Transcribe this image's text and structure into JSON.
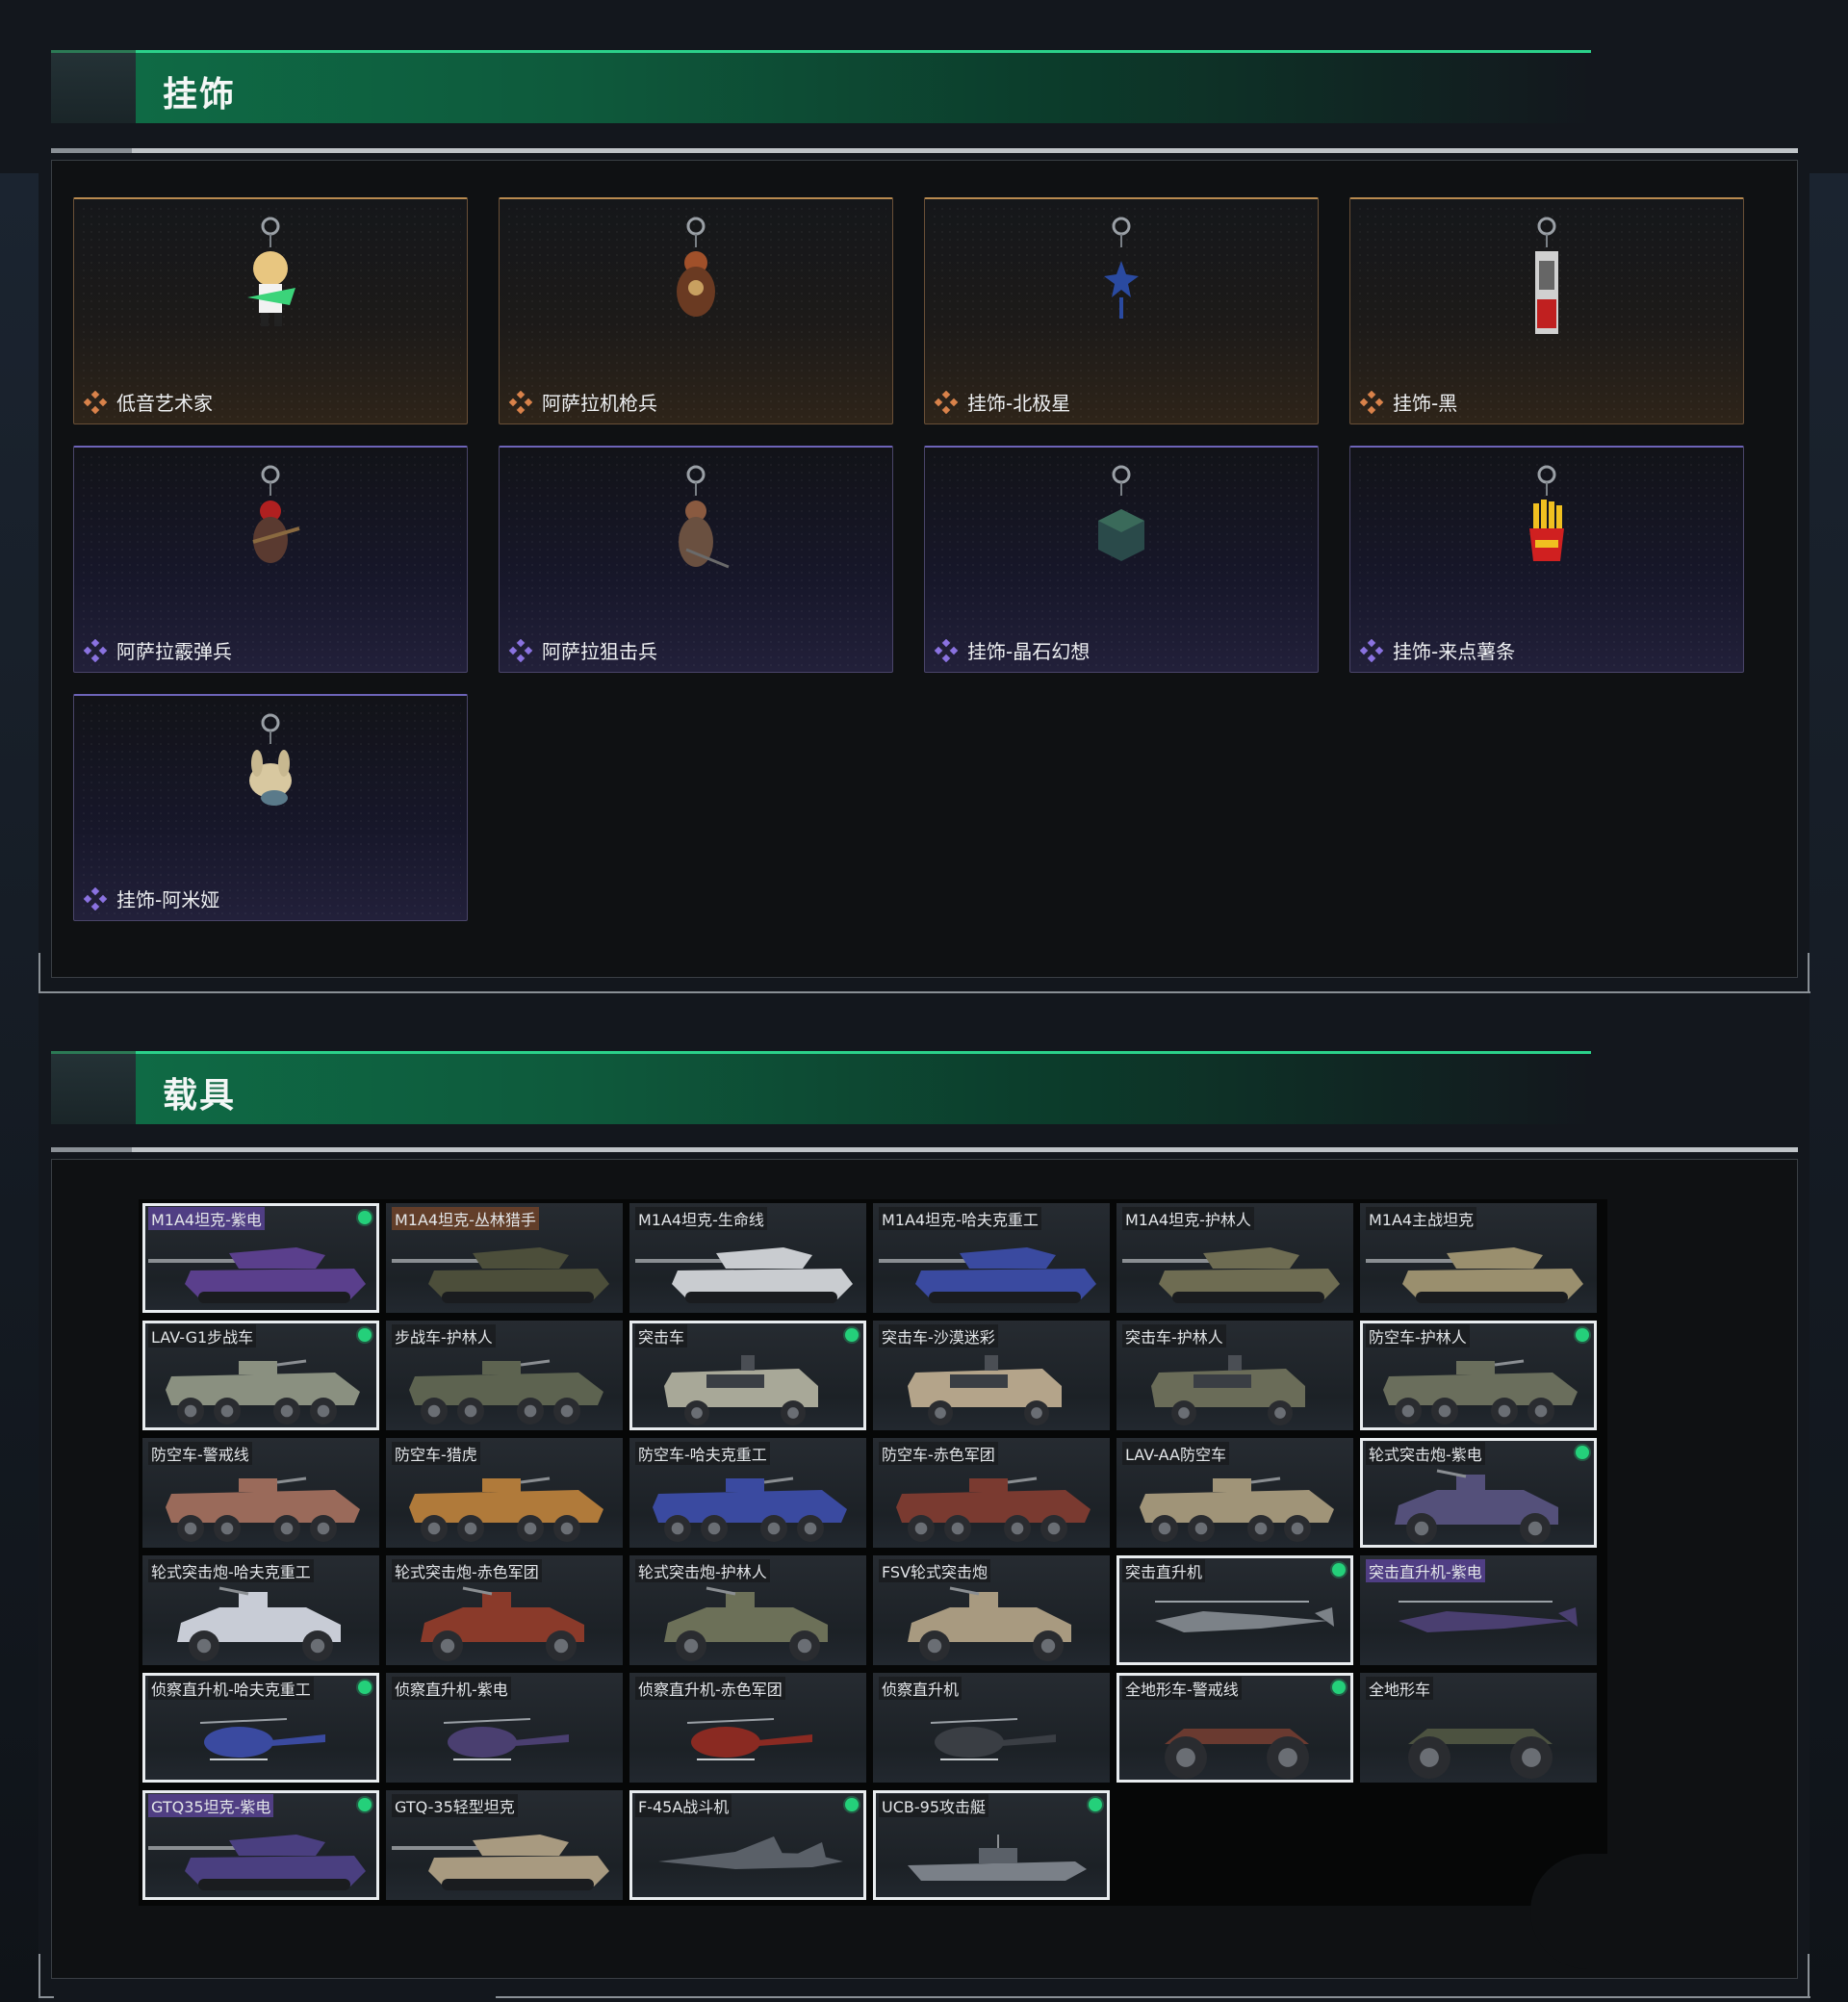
{
  "colors": {
    "accent_green": "#2bd18a",
    "orange_rarity": "#d9824a",
    "purple_rarity": "#8a72e0",
    "owned_dot": "#24d07a"
  },
  "pendants": {
    "title": "挂饰",
    "items": [
      {
        "name": "低音艺术家",
        "rarity": "orange",
        "icon": "bassist-figure-icon"
      },
      {
        "name": "阿萨拉机枪兵",
        "rarity": "orange",
        "icon": "gunner-figure-icon"
      },
      {
        "name": "挂饰-北极星",
        "rarity": "orange",
        "icon": "star-pendant-icon"
      },
      {
        "name": "挂饰-黑",
        "rarity": "orange",
        "icon": "tag-pendant-icon"
      },
      {
        "name": "阿萨拉霰弹兵",
        "rarity": "purple",
        "icon": "shotgunner-figure-icon"
      },
      {
        "name": "阿萨拉狙击兵",
        "rarity": "purple",
        "icon": "sniper-figure-icon"
      },
      {
        "name": "挂饰-晶石幻想",
        "rarity": "purple",
        "icon": "crystal-cube-icon"
      },
      {
        "name": "挂饰-来点薯条",
        "rarity": "purple",
        "icon": "fries-pendant-icon"
      },
      {
        "name": "挂饰-阿米娅",
        "rarity": "purple",
        "icon": "plush-pendant-icon"
      }
    ]
  },
  "vehicles": {
    "title": "载具",
    "items": [
      {
        "name": "M1A4坦克-紫电",
        "type": "tank",
        "tag": "purple",
        "selected": true,
        "owned": true,
        "paint": "#5a3f8c"
      },
      {
        "name": "M1A4坦克-丛林猎手",
        "type": "tank",
        "tag": "orange",
        "selected": false,
        "owned": false,
        "paint": "#4c4e3a"
      },
      {
        "name": "M1A4坦克-生命线",
        "type": "tank",
        "tag": "none",
        "selected": false,
        "owned": false,
        "paint": "#c9ccd0"
      },
      {
        "name": "M1A4坦克-哈夫克重工",
        "type": "tank",
        "tag": "none",
        "selected": false,
        "owned": false,
        "paint": "#3a4aa0"
      },
      {
        "name": "M1A4坦克-护林人",
        "type": "tank",
        "tag": "none",
        "selected": false,
        "owned": false,
        "paint": "#6e6c52"
      },
      {
        "name": "M1A4主战坦克",
        "type": "tank",
        "tag": "none",
        "selected": false,
        "owned": false,
        "paint": "#9a8f6e"
      },
      {
        "name": "LAV-G1步战车",
        "type": "apc",
        "tag": "none",
        "selected": true,
        "owned": true,
        "paint": "#8a9080"
      },
      {
        "name": "步战车-护林人",
        "type": "apc",
        "tag": "none",
        "selected": false,
        "owned": false,
        "paint": "#5d6350"
      },
      {
        "name": "突击车",
        "type": "mrap",
        "tag": "none",
        "selected": true,
        "owned": true,
        "paint": "#a8a898"
      },
      {
        "name": "突击车-沙漠迷彩",
        "type": "mrap",
        "tag": "none",
        "selected": false,
        "owned": false,
        "paint": "#b4a48a"
      },
      {
        "name": "突击车-护林人",
        "type": "mrap",
        "tag": "none",
        "selected": false,
        "owned": false,
        "paint": "#6a6c58"
      },
      {
        "name": "防空车-护林人",
        "type": "apc",
        "tag": "none",
        "selected": true,
        "owned": true,
        "paint": "#6a6e5c"
      },
      {
        "name": "防空车-警戒线",
        "type": "apc",
        "tag": "none",
        "selected": false,
        "owned": false,
        "paint": "#9a6a5a"
      },
      {
        "name": "防空车-猎虎",
        "type": "apc",
        "tag": "none",
        "selected": false,
        "owned": false,
        "paint": "#b07a3a"
      },
      {
        "name": "防空车-哈夫克重工",
        "type": "apc",
        "tag": "none",
        "selected": false,
        "owned": false,
        "paint": "#3a4aa0"
      },
      {
        "name": "防空车-赤色军团",
        "type": "apc",
        "tag": "none",
        "selected": false,
        "owned": false,
        "paint": "#7a3a30"
      },
      {
        "name": "LAV-AA防空车",
        "type": "apc",
        "tag": "none",
        "selected": false,
        "owned": false,
        "paint": "#a09478"
      },
      {
        "name": "轮式突击炮-紫电",
        "type": "buggy",
        "tag": "none",
        "selected": true,
        "owned": true,
        "paint": "#54507a"
      },
      {
        "name": "轮式突击炮-哈夫克重工",
        "type": "buggy",
        "tag": "none",
        "selected": false,
        "owned": false,
        "paint": "#c8ccd6"
      },
      {
        "name": "轮式突击炮-赤色军团",
        "type": "buggy",
        "tag": "none",
        "selected": false,
        "owned": false,
        "paint": "#8a3a2a"
      },
      {
        "name": "轮式突击炮-护林人",
        "type": "buggy",
        "tag": "none",
        "selected": false,
        "owned": false,
        "paint": "#6c7058"
      },
      {
        "name": "FSV轮式突击炮",
        "type": "buggy",
        "tag": "none",
        "selected": false,
        "owned": false,
        "paint": "#a89a80"
      },
      {
        "name": "突击直升机",
        "type": "heli",
        "tag": "none",
        "selected": true,
        "owned": true,
        "paint": "#7c8288"
      },
      {
        "name": "突击直升机-紫电",
        "type": "heli",
        "tag": "purple",
        "selected": false,
        "owned": false,
        "paint": "#4a3f70"
      },
      {
        "name": "侦察直升机-哈夫克重工",
        "type": "scout",
        "tag": "none",
        "selected": true,
        "owned": true,
        "paint": "#3a4aa0"
      },
      {
        "name": "侦察直升机-紫电",
        "type": "scout",
        "tag": "none",
        "selected": false,
        "owned": false,
        "paint": "#4a3f70"
      },
      {
        "name": "侦察直升机-赤色军团",
        "type": "scout",
        "tag": "none",
        "selected": false,
        "owned": false,
        "paint": "#8a2a22"
      },
      {
        "name": "侦察直升机",
        "type": "scout",
        "tag": "none",
        "selected": false,
        "owned": false,
        "paint": "#3a3e44"
      },
      {
        "name": "全地形车-警戒线",
        "type": "atv",
        "tag": "none",
        "selected": true,
        "owned": true,
        "paint": "#6a3a30"
      },
      {
        "name": "全地形车",
        "type": "atv",
        "tag": "none",
        "selected": false,
        "owned": false,
        "paint": "#4c5240"
      },
      {
        "name": "GTQ35坦克-紫电",
        "type": "tank",
        "tag": "purple",
        "selected": true,
        "owned": true,
        "paint": "#4a3f80"
      },
      {
        "name": "GTQ-35轻型坦克",
        "type": "tank",
        "tag": "none",
        "selected": false,
        "owned": false,
        "paint": "#a89a80"
      },
      {
        "name": "F-45A战斗机",
        "type": "jet",
        "tag": "none",
        "selected": true,
        "owned": true,
        "paint": "#5a6068"
      },
      {
        "name": "UCB-95攻击艇",
        "type": "boat",
        "tag": "none",
        "selected": true,
        "owned": true,
        "paint": "#7a8088"
      }
    ]
  }
}
